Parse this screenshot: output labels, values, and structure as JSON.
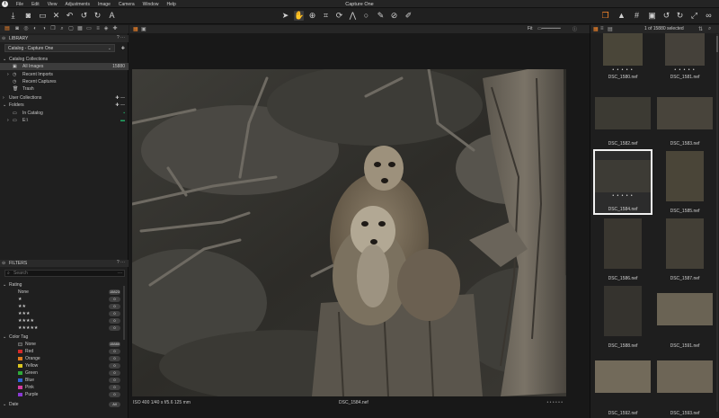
{
  "menubar": {
    "logo": "i",
    "items": [
      "File",
      "Edit",
      "View",
      "Adjustments",
      "Image",
      "Camera",
      "Window",
      "Help"
    ],
    "title": "Capture One"
  },
  "library": {
    "title": "LIBRARY",
    "catalog_select": "Catalog - Capture One",
    "catalog_collections": "Catalog Collections",
    "all_images": "All Images",
    "all_images_count": "15880",
    "recent_imports": "Recent Imports",
    "recent_captures": "Recent Captures",
    "trash": "Trash",
    "user_collections": "User Collections",
    "folders": "Folders",
    "in_catalog": "In Catalog",
    "drive": "E:\\"
  },
  "filters": {
    "title": "FILTERS",
    "search_placeholder": "Search",
    "rating_label": "Rating",
    "rating_rows": [
      {
        "label": "None",
        "count": "15823"
      },
      {
        "label": "★",
        "count": "0"
      },
      {
        "label": "★★",
        "count": "0"
      },
      {
        "label": "★★★",
        "count": "0"
      },
      {
        "label": "★★★★",
        "count": "0"
      },
      {
        "label": "★★★★★",
        "count": "0"
      }
    ],
    "color_label": "Color Tag",
    "color_rows": [
      {
        "label": "None",
        "count": "15880",
        "color": "#3a3a3a"
      },
      {
        "label": "Red",
        "count": "0",
        "color": "#d32a2a"
      },
      {
        "label": "Orange",
        "count": "0",
        "color": "#e07a1e"
      },
      {
        "label": "Yellow",
        "count": "0",
        "color": "#d9c521"
      },
      {
        "label": "Green",
        "count": "0",
        "color": "#2faa3a"
      },
      {
        "label": "Blue",
        "count": "0",
        "color": "#2f63d3"
      },
      {
        "label": "Pink",
        "count": "0",
        "color": "#d33da0"
      },
      {
        "label": "Purple",
        "count": "0",
        "color": "#8a3ad3"
      }
    ],
    "date_label": "Date",
    "date_count": "All"
  },
  "viewer": {
    "zoom": "Fit",
    "info_left": "ISO 400 1/40 s f/5.6 125 mm",
    "info_center": "DSC_1584.nef",
    "info_right": "• • • • • •"
  },
  "browser": {
    "count_text": "1 of 15880 selected",
    "dots": "• • • • •",
    "thumbs": [
      {
        "name": "DSC_1580.nef"
      },
      {
        "name": "DSC_1581.nef"
      },
      {
        "name": "DSC_1582.nef"
      },
      {
        "name": "DSC_1583.nef"
      },
      {
        "name": "DSC_1584.nef"
      },
      {
        "name": "DSC_1585.nef"
      },
      {
        "name": "DSC_1586.nef"
      },
      {
        "name": "DSC_1587.nef"
      },
      {
        "name": "DSC_1588.nef"
      },
      {
        "name": "DSC_1591.nef"
      },
      {
        "name": "DSC_1592.nef"
      },
      {
        "name": "DSC_1593.nef"
      }
    ]
  },
  "colors": {
    "accent": "#ff8a2a",
    "panel": "#1f1f1f",
    "selected_row": "#3c3c3c"
  }
}
